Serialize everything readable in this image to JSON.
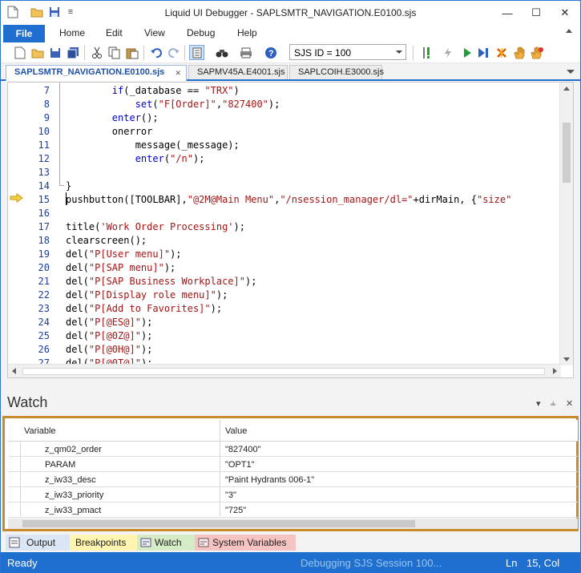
{
  "window": {
    "title": "Liquid UI Debugger - SAPLSMTR_NAVIGATION.E0100.sjs",
    "minimize_glyph": "—",
    "maximize_glyph": "☐",
    "close_glyph": "✕",
    "quick_access_more": "≡"
  },
  "menu": {
    "file": "File",
    "home": "Home",
    "edit": "Edit",
    "view": "View",
    "debug": "Debug",
    "help": "Help"
  },
  "toolbar": {
    "sjs_id_value": "SJS ID = 100",
    "icons": [
      "new-file-icon",
      "open-folder-icon",
      "save-icon",
      "save-all-icon",
      "cut-icon",
      "copy-icon",
      "paste-icon",
      "undo-icon",
      "redo-icon",
      "document-view-icon",
      "find-icon",
      "print-icon",
      "help-icon",
      "breakpoint-icon",
      "lightning-icon",
      "run-icon",
      "step-icon",
      "stop-icon",
      "hand-icon",
      "hand-all-icon"
    ]
  },
  "doc_tabs": [
    {
      "label": "SAPLSMTR_NAVIGATION.E0100.sjs",
      "active": true
    },
    {
      "label": "SAPMV45A.E4001.sjs",
      "active": false
    },
    {
      "label": "SAPLCOIH.E3000.sjs",
      "active": false
    }
  ],
  "editor": {
    "line_numbers": [
      "7",
      "8",
      "9",
      "10",
      "11",
      "12",
      "13",
      "14",
      "15",
      "16",
      "17",
      "18",
      "19",
      "20",
      "21",
      "22",
      "23",
      "24",
      "25",
      "26",
      "27"
    ],
    "current_line": "15"
  },
  "watch": {
    "title": "Watch",
    "headers": {
      "variable": "Variable",
      "value": "Value"
    },
    "rows": [
      {
        "variable": "z_qm02_order",
        "value": "\"827400\""
      },
      {
        "variable": "PARAM",
        "value": "\"OPT1\""
      },
      {
        "variable": "z_iw33_desc",
        "value": "\"Paint Hydrants 006-1\""
      },
      {
        "variable": "z_iw33_priority",
        "value": "\"3\""
      },
      {
        "variable": "z_iw33_pmact",
        "value": "\"725\""
      }
    ],
    "ctl_dropdown": "▾",
    "ctl_pin": "⫨",
    "ctl_close": "✕"
  },
  "bottom_tabs": [
    {
      "label": "Output",
      "color": "#dbe6f4"
    },
    {
      "label": "Breakpoints",
      "color": "#fff5b0"
    },
    {
      "label": "Watch",
      "color": "#d6ecc6"
    },
    {
      "label": "System Variables",
      "color": "#f6c3c3"
    }
  ],
  "status": {
    "ready": "Ready",
    "session": "Debugging SJS Session 100...",
    "ln_label": "Ln",
    "position": "15, Col"
  },
  "colors": {
    "accent": "#1e6fcf",
    "watch_border": "#c88a2a",
    "keyword": "#0000cc",
    "string": "#a31515"
  }
}
